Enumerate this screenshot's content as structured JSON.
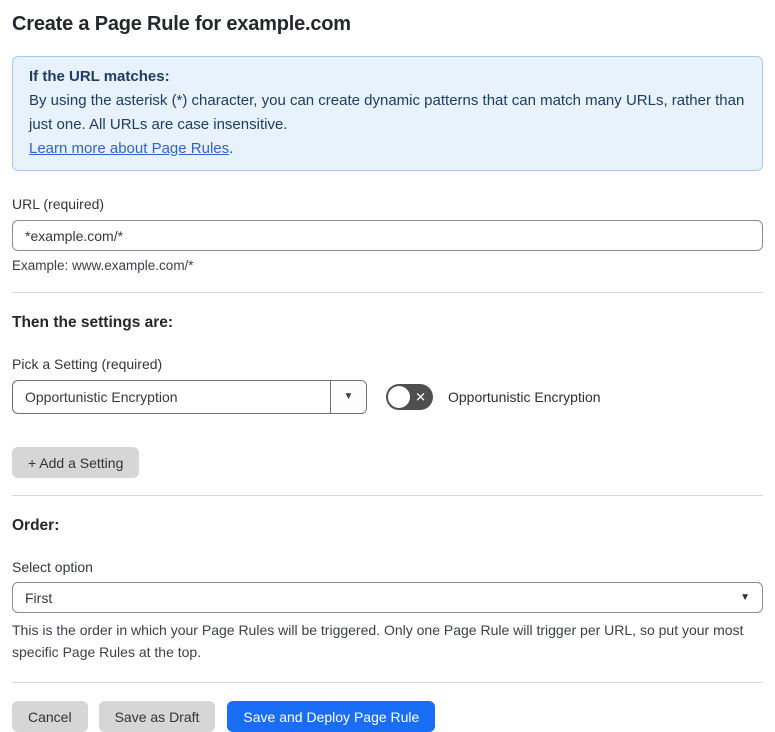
{
  "page": {
    "title": "Create a Page Rule for example.com"
  },
  "info_box": {
    "heading": "If the URL matches:",
    "body": "By using the asterisk (*) character, you can create dynamic patterns that can match many URLs, rather than just one. All URLs are case insensitive.",
    "link_label": "Learn more about Page Rules",
    "link_suffix": "."
  },
  "url_field": {
    "label": "URL (required)",
    "value": "*example.com/*",
    "example": "Example: www.example.com/*"
  },
  "settings": {
    "heading": "Then the settings are:",
    "pick_label": "Pick a Setting (required)",
    "selected_setting": "Opportunistic Encryption",
    "toggle": {
      "state": "off",
      "label": "Opportunistic Encryption"
    },
    "add_button_label": "+ Add a Setting"
  },
  "order": {
    "heading": "Order:",
    "select_label": "Select option",
    "selected_option": "First",
    "help": "This is the order in which your Page Rules will be triggered. Only one Page Rule will trigger per URL, so put your most specific Page Rules at the top."
  },
  "footer": {
    "buttons": [
      {
        "label": "Cancel",
        "variant": "gray"
      },
      {
        "label": "Save as Draft",
        "variant": "gray"
      },
      {
        "label": "Save and Deploy Page Rule",
        "variant": "blue"
      }
    ]
  },
  "icons": {
    "caret_down": "▼",
    "toggle_off_x": "✕"
  },
  "colors": {
    "accent_blue": "#1a6ef5",
    "info_background": "#e8f2fc",
    "info_border": "#a9c9ee",
    "info_text": "#1d3c66",
    "link_blue": "#2f64c9",
    "toggle_off_background": "#4f4f4f",
    "gray_button": "#d6d6d6",
    "divider": "#d8d8d8"
  }
}
